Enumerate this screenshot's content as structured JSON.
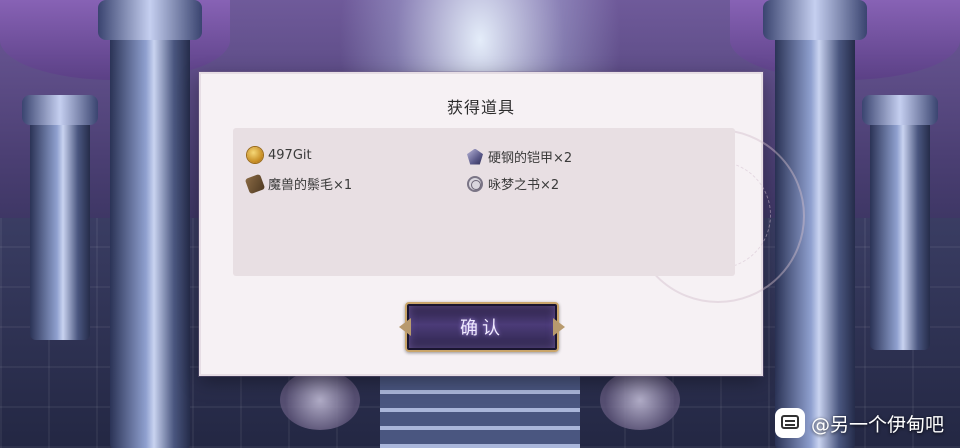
{
  "dialog": {
    "title": "获得道具",
    "items": [
      {
        "name": "497Git",
        "icon": "coin-icon"
      },
      {
        "name": "硬钢的铠甲×2",
        "icon": "armor-gem-icon"
      },
      {
        "name": "魔兽的鬃毛×1",
        "icon": "beast-mane-icon"
      },
      {
        "name": "咏梦之书×2",
        "icon": "dream-book-icon"
      }
    ],
    "confirm_label": "确认"
  },
  "watermark": {
    "text": "@另一个伊甸吧",
    "icon": "tieba-logo-icon"
  },
  "colors": {
    "dialog_bg": "#f6f1f4",
    "panel_bg": "#e8dfe3",
    "button_border": "#c9a56a",
    "button_bg": "#4b3b78"
  }
}
